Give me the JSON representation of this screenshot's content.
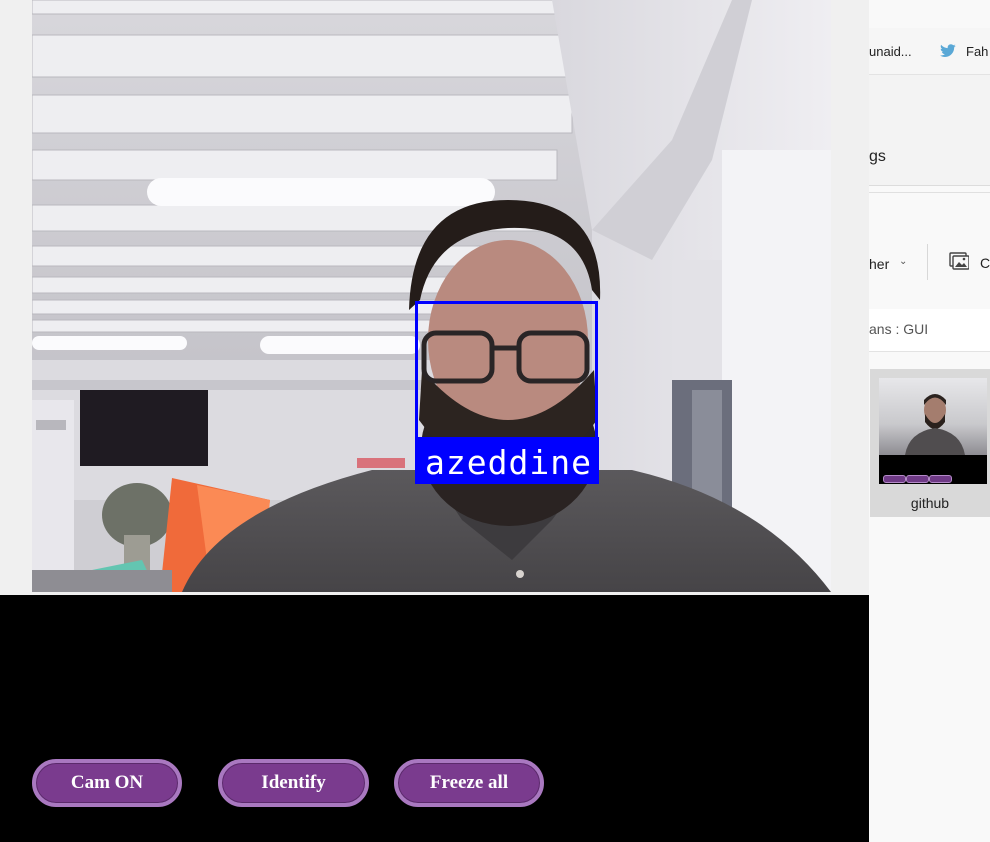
{
  "background_window": {
    "bookmarks": [
      {
        "label": "unaid...",
        "icon": "globe-icon"
      },
      {
        "label": "Fah",
        "icon": "twitter-icon"
      }
    ],
    "ribbon_label": "gs",
    "command_bar": {
      "item_label": "her",
      "next_item_letter": "C"
    },
    "path_text": "ans : GUI",
    "file": {
      "name": "github",
      "icon": "image-thumbnail-icon"
    },
    "colors": {
      "selection": "#d9d9d9",
      "twitter_blue": "#1da1f2"
    }
  },
  "app": {
    "video": {
      "detected_name": "azeddine",
      "box_color": "#0000ff"
    },
    "buttons": {
      "cam_on": "Cam ON",
      "identify": "Identify",
      "freeze_all": "Freeze all"
    },
    "colors": {
      "button_fill": "#7a3b8e",
      "button_border": "#a978c0",
      "panel_bg": "#000000"
    }
  }
}
